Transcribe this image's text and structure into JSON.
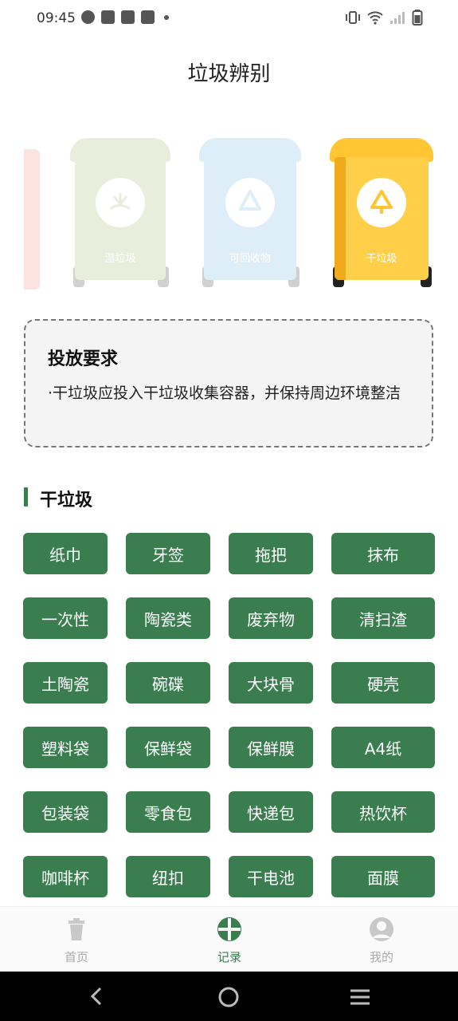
{
  "status": {
    "time": "09:45"
  },
  "header": {
    "title": "垃圾辨别"
  },
  "bins": [
    {
      "label": "湿垃圾",
      "color": "#e8eedb",
      "icon": "food-waste-icon"
    },
    {
      "label": "可回收物",
      "color": "#deeef8",
      "icon": "recycle-icon"
    },
    {
      "label": "干垃圾",
      "color": "#ffc532",
      "icon": "dry-waste-icon"
    }
  ],
  "requirement": {
    "title": "投放要求",
    "text": "·干垃圾应投入干垃圾收集容器，并保持周边环境整洁"
  },
  "section": {
    "title": "干垃圾"
  },
  "tags": [
    "纸巾",
    "牙签",
    "拖把",
    "抹布",
    "一次性",
    "陶瓷类",
    "废弃物",
    "清扫渣",
    "土陶瓷",
    "碗碟",
    "大块骨",
    "硬壳",
    "塑料袋",
    "保鲜袋",
    "保鲜膜",
    "A4纸",
    "包装袋",
    "零食包",
    "快递包",
    "热饮杯",
    "咖啡杯",
    "纽扣",
    "干电池",
    "面膜"
  ],
  "nav": {
    "items": [
      {
        "label": "首页",
        "icon": "trash-bin-icon"
      },
      {
        "label": "记录",
        "icon": "record-circle-icon"
      },
      {
        "label": "我的",
        "icon": "user-icon"
      }
    ],
    "active_index": 1
  },
  "colors": {
    "accent": "#3a7d4f"
  }
}
